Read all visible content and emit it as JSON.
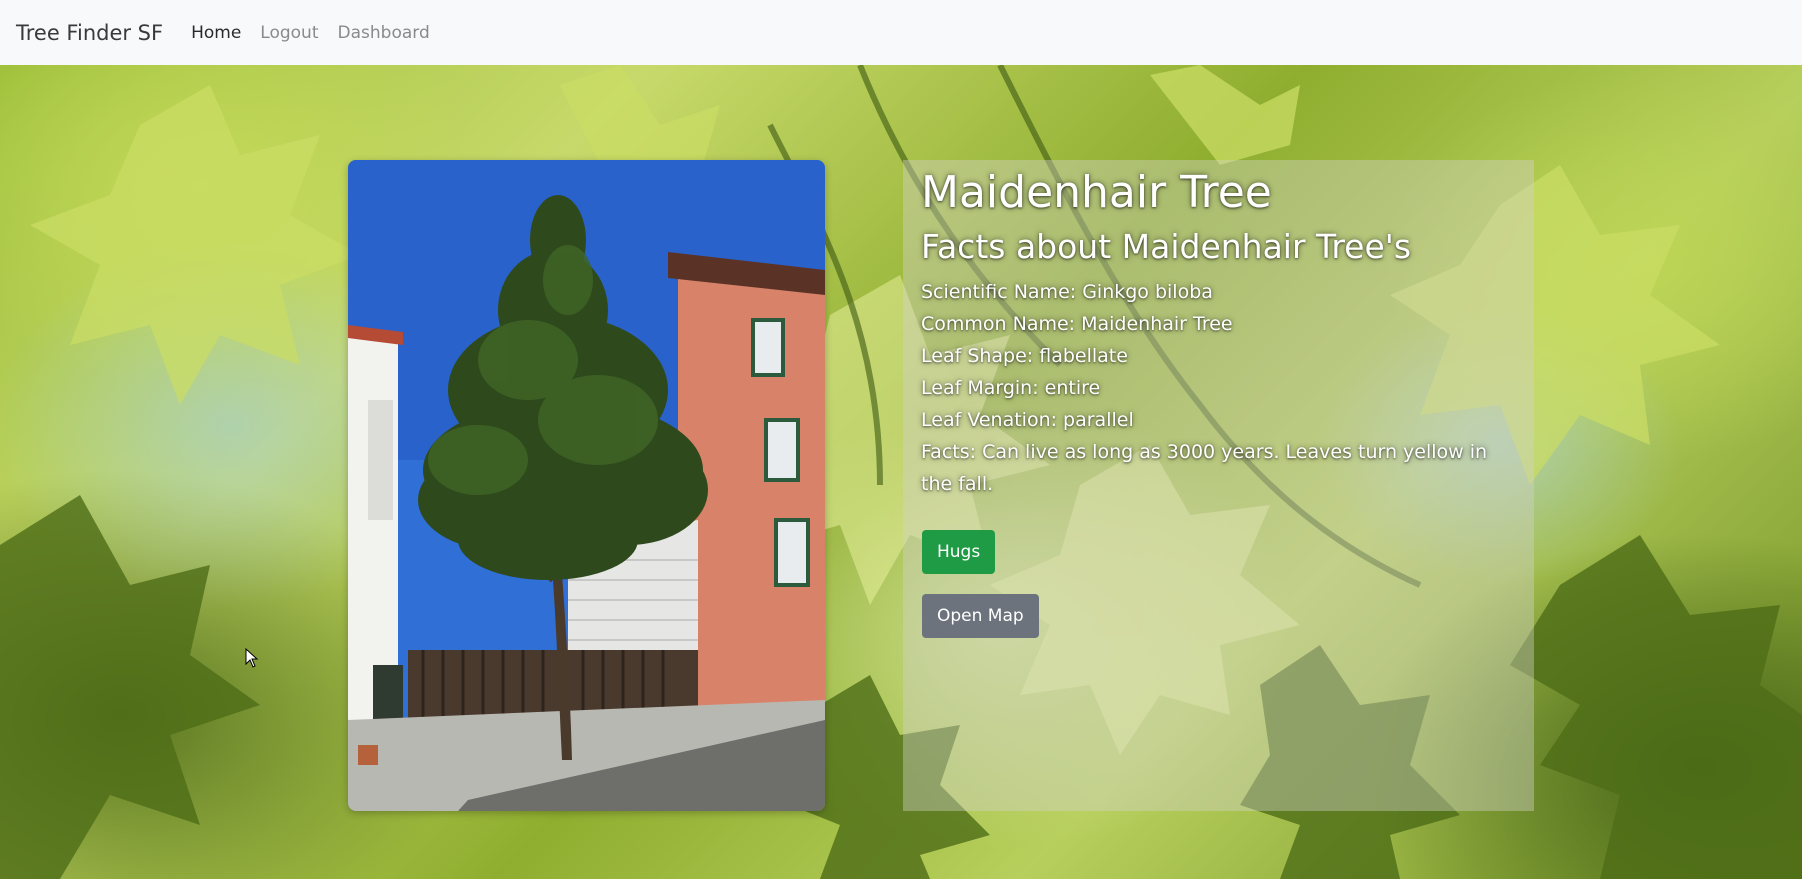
{
  "navbar": {
    "brand": "Tree Finder SF",
    "links": [
      {
        "label": "Home",
        "active": true
      },
      {
        "label": "Logout",
        "active": false
      },
      {
        "label": "Dashboard",
        "active": false
      }
    ]
  },
  "tree": {
    "title": "Maidenhair Tree",
    "subtitle": "Facts about Maidenhair Tree's",
    "facts": [
      "Scientific Name: Ginkgo biloba",
      "Common Name: Maidenhair Tree",
      "Leaf Shape: flabellate",
      "Leaf Margin: entire",
      "Leaf Venation: parallel",
      "Facts: Can live as long as 3000 years. Leaves turn yellow in the fall."
    ]
  },
  "buttons": {
    "hugs_label": "Hugs",
    "map_label": "Open Map"
  },
  "colors": {
    "navbar_bg": "#f8f9fa",
    "hugs_button": "#1f9a45",
    "map_button": "#6c737c"
  },
  "icons": {
    "cursor": "mouse-cursor-icon"
  }
}
